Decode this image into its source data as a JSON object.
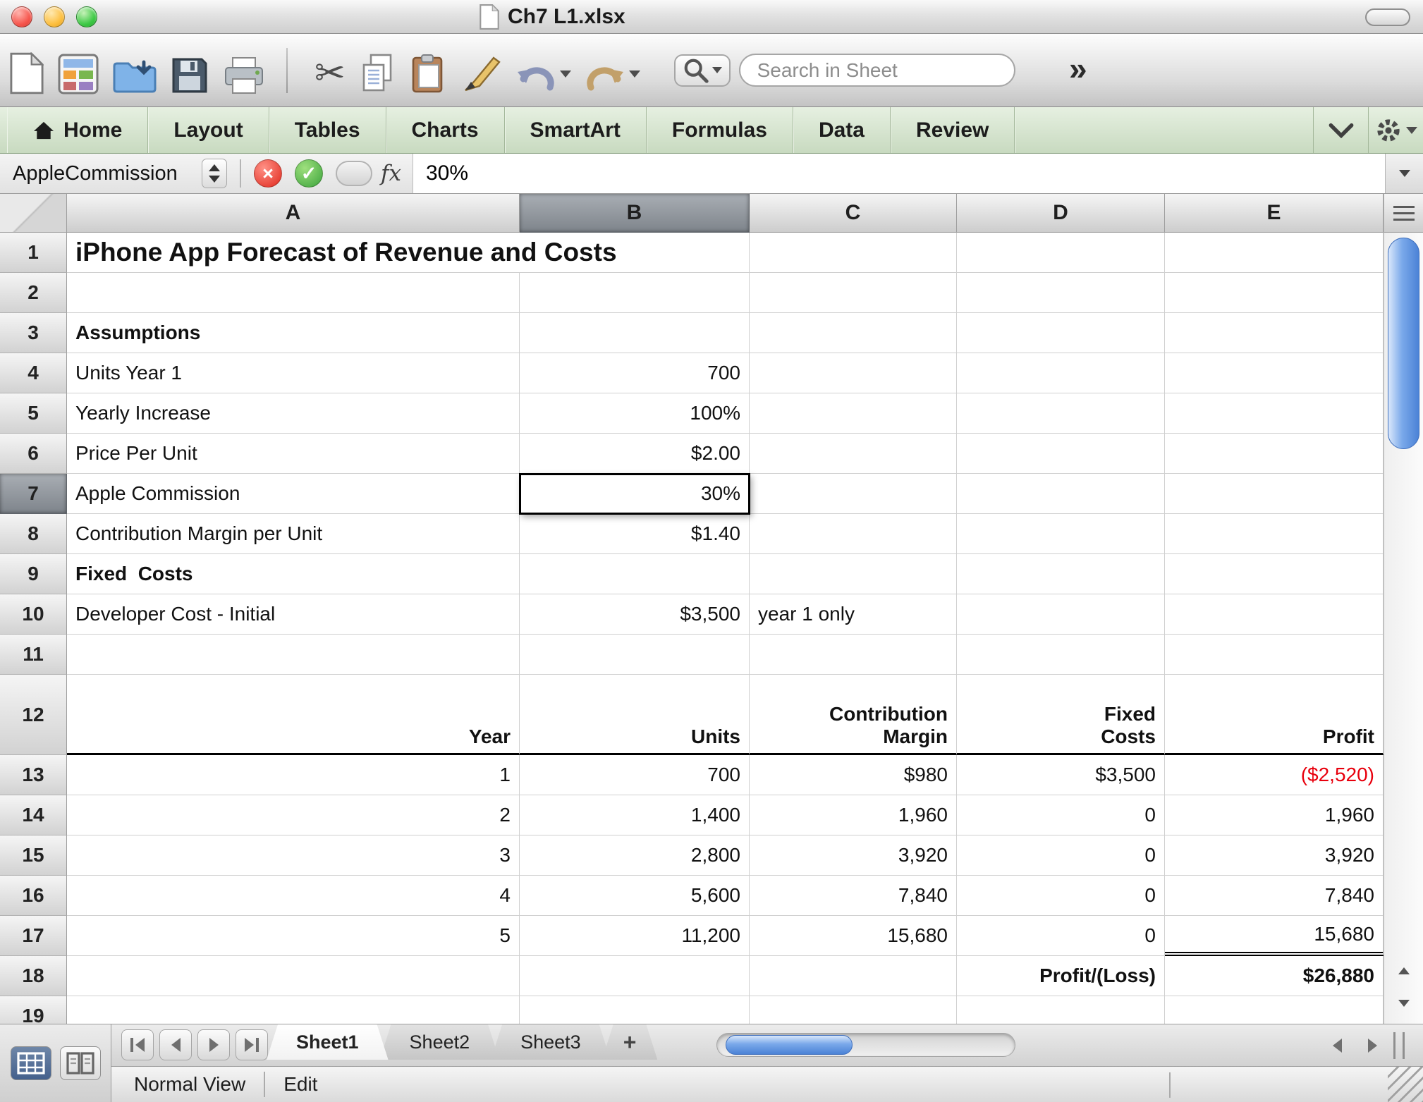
{
  "window": {
    "title": "Ch7 L1.xlsx",
    "search_placeholder": "Search in Sheet",
    "overflow_chevron": "»"
  },
  "icons": {
    "cut": "✂",
    "cancel": "×",
    "accept": "✓"
  },
  "ribbon": {
    "tabs": [
      "Home",
      "Layout",
      "Tables",
      "Charts",
      "SmartArt",
      "Formulas",
      "Data",
      "Review"
    ]
  },
  "formula_bar": {
    "name_box": "AppleCommission",
    "fx_label": "fx",
    "value": "30%"
  },
  "grid": {
    "columns": [
      "A",
      "B",
      "C",
      "D",
      "E"
    ],
    "selected_column": "B",
    "selected_row": "7",
    "rows": [
      {
        "num": "1",
        "cells": [
          "iPhone App Forecast of Revenue and Costs",
          "",
          "",
          "",
          ""
        ]
      },
      {
        "num": "2",
        "cells": [
          "",
          "",
          "",
          "",
          ""
        ]
      },
      {
        "num": "3",
        "cells": [
          "Assumptions",
          "",
          "",
          "",
          ""
        ]
      },
      {
        "num": "4",
        "cells": [
          "Units Year 1",
          "700",
          "",
          "",
          ""
        ]
      },
      {
        "num": "5",
        "cells": [
          "Yearly Increase",
          "100%",
          "",
          "",
          ""
        ]
      },
      {
        "num": "6",
        "cells": [
          "Price Per Unit",
          "$2.00",
          "",
          "",
          ""
        ]
      },
      {
        "num": "7",
        "cells": [
          "Apple Commission",
          "30%",
          "",
          "",
          ""
        ]
      },
      {
        "num": "8",
        "cells": [
          "Contribution Margin per Unit",
          "$1.40",
          "",
          "",
          ""
        ]
      },
      {
        "num": "9",
        "cells": [
          "Fixed  Costs",
          "",
          "",
          "",
          ""
        ]
      },
      {
        "num": "10",
        "cells": [
          "Developer Cost - Initial",
          "$3,500",
          "year 1 only",
          "",
          ""
        ]
      },
      {
        "num": "11",
        "cells": [
          "",
          "",
          "",
          "",
          ""
        ]
      },
      {
        "num": "12",
        "cells": [
          "Year",
          "Units",
          "Contribution\nMargin",
          "Fixed\nCosts",
          "Profit"
        ]
      },
      {
        "num": "13",
        "cells": [
          "1",
          "700",
          "$980",
          "$3,500",
          "($2,520)"
        ]
      },
      {
        "num": "14",
        "cells": [
          "2",
          "1,400",
          "1,960",
          "0",
          "1,960"
        ]
      },
      {
        "num": "15",
        "cells": [
          "3",
          "2,800",
          "3,920",
          "0",
          "3,920"
        ]
      },
      {
        "num": "16",
        "cells": [
          "4",
          "5,600",
          "7,840",
          "0",
          "7,840"
        ]
      },
      {
        "num": "17",
        "cells": [
          "5",
          "11,200",
          "15,680",
          "0",
          "15,680"
        ]
      },
      {
        "num": "18",
        "cells": [
          "",
          "",
          "",
          "Profit/(Loss)",
          "$26,880"
        ]
      },
      {
        "num": "19",
        "cells": [
          "",
          "",
          "",
          "",
          ""
        ]
      }
    ]
  },
  "sheet_bar": {
    "tabs": [
      "Sheet1",
      "Sheet2",
      "Sheet3"
    ],
    "active_tab": "Sheet1",
    "add_label": "+"
  },
  "status_bar": {
    "view_label": "Normal View",
    "mode_label": "Edit"
  },
  "colors": {
    "negative_red": "#e8000d",
    "scrollbar_blue": "#4b82d6",
    "ribbon_green": "#cfe0c8",
    "selection_border": "#000000"
  }
}
